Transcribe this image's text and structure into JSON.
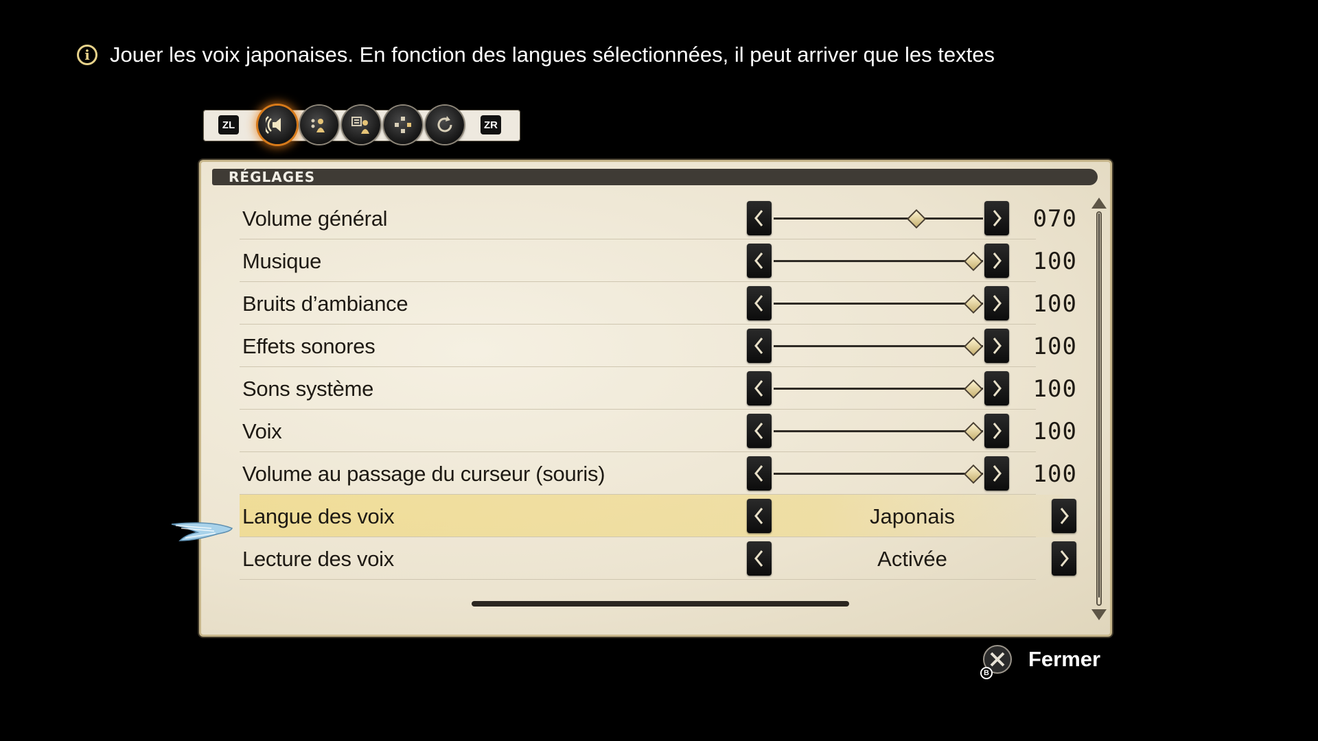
{
  "hint": {
    "text": "Jouer les voix japonaises. En fonction des langues sélectionnées, il peut arriver que les textes"
  },
  "tabs": {
    "left_shoulder": "ZL",
    "right_shoulder": "ZR",
    "items": [
      {
        "icon": "sound-icon",
        "active": true
      },
      {
        "icon": "party-icon",
        "active": false
      },
      {
        "icon": "display-text-icon",
        "active": false
      },
      {
        "icon": "gamepad-icon",
        "active": false
      },
      {
        "icon": "reset-icon",
        "active": false
      }
    ]
  },
  "panel": {
    "title": "RÉGLAGES",
    "rows": [
      {
        "label": "Volume général",
        "type": "slider",
        "value": "070",
        "level": 70
      },
      {
        "label": "Musique",
        "type": "slider",
        "value": "100",
        "level": 100
      },
      {
        "label": "Bruits d’ambiance",
        "type": "slider",
        "value": "100",
        "level": 100
      },
      {
        "label": "Effets sonores",
        "type": "slider",
        "value": "100",
        "level": 100
      },
      {
        "label": "Sons système",
        "type": "slider",
        "value": "100",
        "level": 100
      },
      {
        "label": "Voix",
        "type": "slider",
        "value": "100",
        "level": 100
      },
      {
        "label": "Volume au passage du curseur (souris)",
        "type": "slider",
        "value": "100",
        "level": 100
      },
      {
        "label": "Langue des voix",
        "type": "choice",
        "value": "Japonais",
        "selected": true
      },
      {
        "label": "Lecture des voix",
        "type": "choice",
        "value": "Activée"
      }
    ]
  },
  "footer": {
    "close_label": "Fermer",
    "close_button_glyph": "B"
  },
  "colors": {
    "accent": "#d77a1a",
    "panel_bg": "#ece4d0",
    "selected_row": "#f0d778",
    "title_bar": "#3f3b35"
  }
}
